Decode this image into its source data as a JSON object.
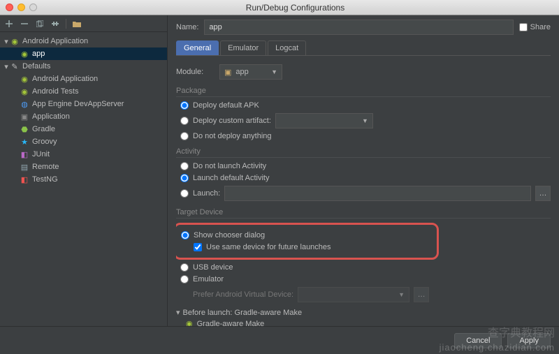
{
  "window": {
    "title": "Run/Debug Configurations"
  },
  "name_label": "Name:",
  "name_value": "app",
  "share_label": "Share",
  "tree": {
    "root_android": "Android Application",
    "root_android_child": "app",
    "defaults": "Defaults",
    "items": [
      "Android Application",
      "Android Tests",
      "App Engine DevAppServer",
      "Application",
      "Gradle",
      "Groovy",
      "JUnit",
      "Remote",
      "TestNG"
    ]
  },
  "tabs": [
    "General",
    "Emulator",
    "Logcat"
  ],
  "module_label": "Module:",
  "module_value": "app",
  "sections": {
    "package": {
      "title": "Package",
      "deploy_default": "Deploy default APK",
      "deploy_custom": "Deploy custom artifact:",
      "do_not_deploy": "Do not deploy anything"
    },
    "activity": {
      "title": "Activity",
      "do_not_launch": "Do not launch Activity",
      "launch_default": "Launch default Activity",
      "launch": "Launch:"
    },
    "target": {
      "title": "Target Device",
      "show_chooser": "Show chooser dialog",
      "use_same": "Use same device for future launches",
      "usb": "USB device",
      "emulator": "Emulator",
      "prefer_avd": "Prefer Android Virtual Device:"
    }
  },
  "before_launch": {
    "title": "Before launch: Gradle-aware Make",
    "item": "Gradle-aware Make"
  },
  "buttons": {
    "cancel": "Cancel",
    "apply": "Apply"
  },
  "watermark": "查字典教程网",
  "watermark2": "jiaocheng.chazidian.com"
}
